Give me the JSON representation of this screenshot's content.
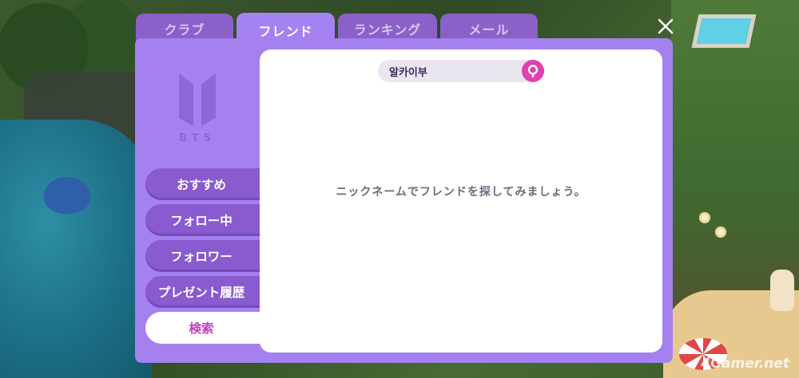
{
  "tabs": [
    {
      "label": "クラブ",
      "active": false
    },
    {
      "label": "フレンド",
      "active": true
    },
    {
      "label": "ランキング",
      "active": false
    },
    {
      "label": "メール",
      "active": false
    }
  ],
  "logo": {
    "text": "BTS",
    "icon": "bts-logo-icon"
  },
  "sidebar": {
    "items": [
      {
        "label": "おすすめ",
        "active": false
      },
      {
        "label": "フォロー中",
        "active": false
      },
      {
        "label": "フォロワー",
        "active": false
      },
      {
        "label": "プレゼント履歴",
        "active": false
      },
      {
        "label": "検索",
        "active": true
      }
    ]
  },
  "search": {
    "value": "알카이부",
    "button_icon": "search-icon"
  },
  "main": {
    "message": "ニックネームでフレンドを探してみましょう。"
  },
  "close_icon": "close-icon",
  "watermark": "4Gamer.net",
  "colors": {
    "panel": "#a581f0",
    "tab_inactive": "#8b60c9",
    "sidebar_button": "#8a5acf",
    "accent_pink": "#e43fb0",
    "active_text": "#c23fbf"
  }
}
